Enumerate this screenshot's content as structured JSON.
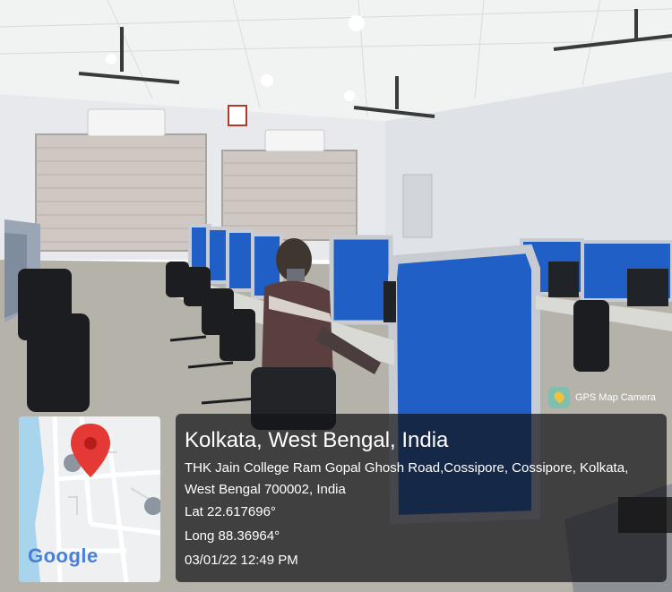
{
  "photo": {
    "subject": "computer lab with blue partitioned workstations",
    "colors": {
      "partition_blue": "#1f5fc6",
      "partition_frame": "#c8ccd2",
      "wall": "#e9ebee",
      "floor": "#b9b6ae"
    }
  },
  "gps_overlay": {
    "badge": "GPS Map Camera",
    "city": "Kolkata, West Bengal, India",
    "address_line1": "THK Jain College Ram Gopal Ghosh Road,Cossipore, Cossipore, Kolkata,",
    "address_line2": "West Bengal 700002, India",
    "latitude": "Lat 22.617696°",
    "longitude": "Long 88.36964°",
    "datetime": "03/01/22 12:49 PM",
    "map_logo": "Google"
  }
}
